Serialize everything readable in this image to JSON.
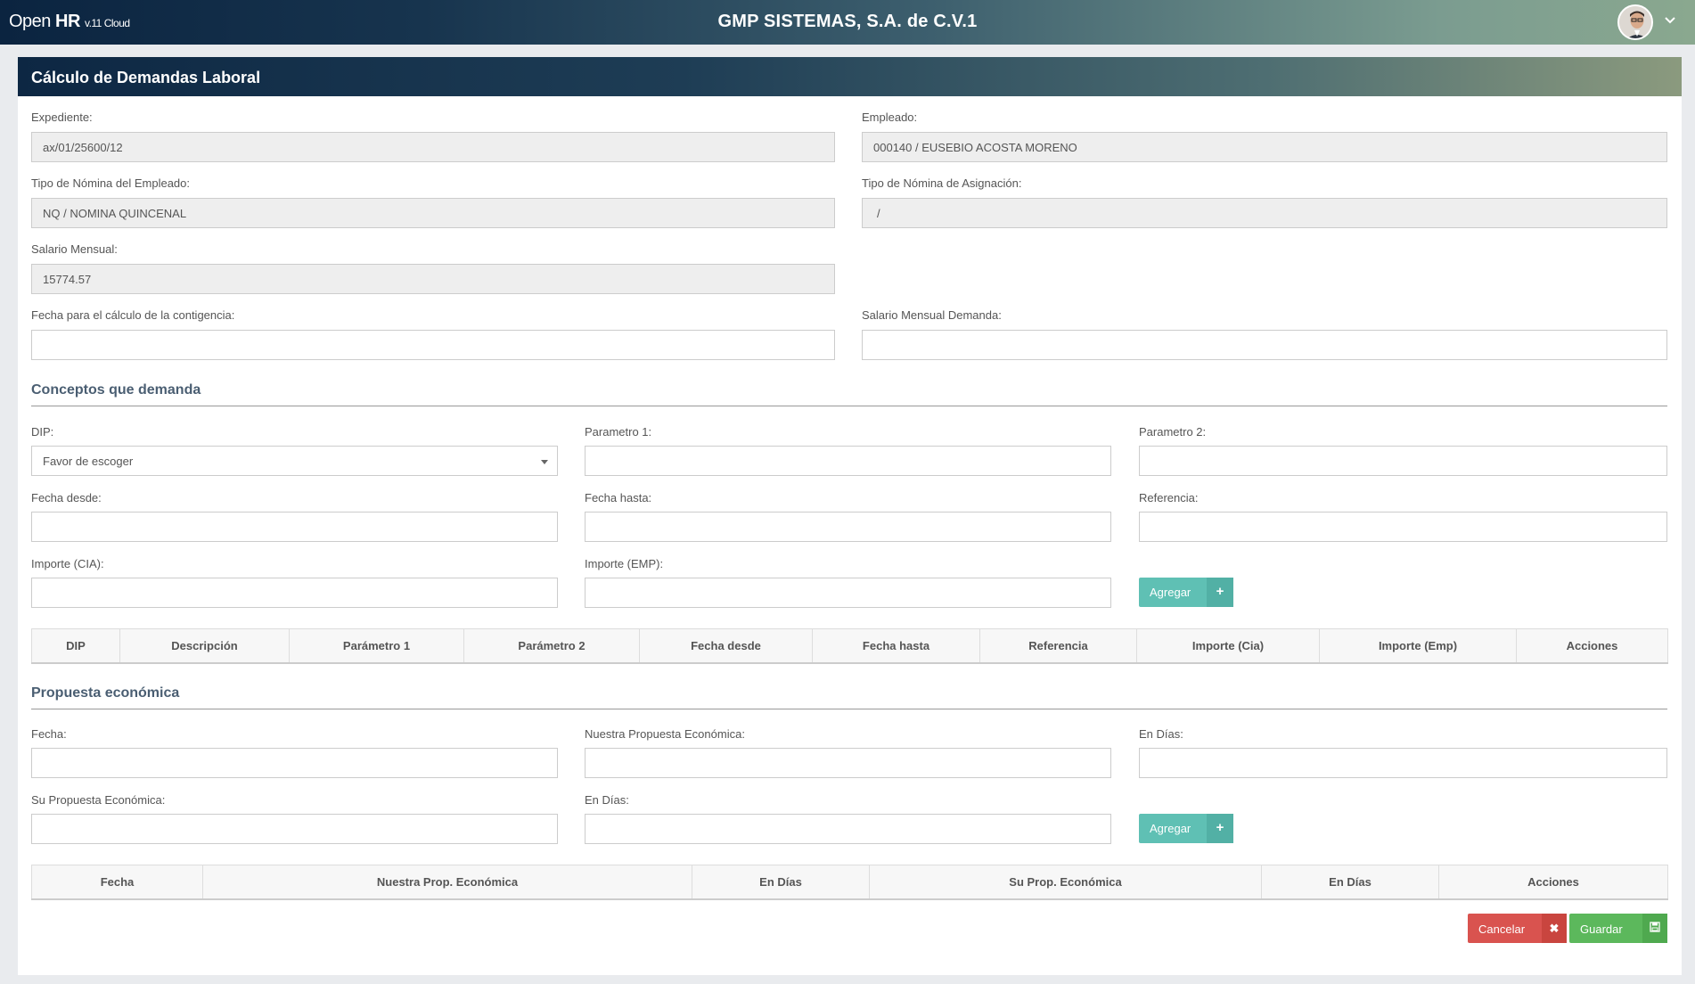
{
  "brand": {
    "open": "Open",
    "hr": "HR",
    "version": "v.11 Cloud"
  },
  "company": "GMP SISTEMAS, S.A. de C.V.1",
  "title": "Cálculo de Demandas Laboral",
  "fields": {
    "expediente": {
      "label": "Expediente:",
      "value": "ax/01/25600/12"
    },
    "empleado": {
      "label": "Empleado:",
      "value": "000140 / EUSEBIO ACOSTA MORENO"
    },
    "tipo_nomina_empleado": {
      "label": "Tipo de Nómina del Empleado:",
      "value": "NQ / NOMINA QUINCENAL"
    },
    "tipo_nomina_asignacion": {
      "label": "Tipo de Nómina de Asignación:",
      "value": "/"
    },
    "salario_mensual": {
      "label": "Salario Mensual:",
      "value": "15774.57"
    },
    "fecha_contingencia": {
      "label": "Fecha para el cálculo de la contigencia:",
      "value": ""
    },
    "salario_mensual_demanda": {
      "label": "Salario Mensual Demanda:",
      "value": ""
    }
  },
  "conceptos": {
    "heading": "Conceptos que demanda",
    "dip": {
      "label": "DIP:",
      "value": "Favor de escoger"
    },
    "parametro1": {
      "label": "Parametro 1:",
      "value": ""
    },
    "parametro2": {
      "label": "Parametro 2:",
      "value": ""
    },
    "fecha_desde": {
      "label": "Fecha desde:",
      "value": ""
    },
    "fecha_hasta": {
      "label": "Fecha hasta:",
      "value": ""
    },
    "referencia": {
      "label": "Referencia:",
      "value": ""
    },
    "importe_cia": {
      "label": "Importe (CIA):",
      "value": ""
    },
    "importe_emp": {
      "label": "Importe (EMP):",
      "value": ""
    },
    "add_label": "Agregar",
    "columns": [
      "DIP",
      "Descripción",
      "Parámetro 1",
      "Parámetro 2",
      "Fecha desde",
      "Fecha hasta",
      "Referencia",
      "Importe (Cia)",
      "Importe (Emp)",
      "Acciones"
    ]
  },
  "propuesta": {
    "heading": "Propuesta económica",
    "fecha": {
      "label": "Fecha:",
      "value": ""
    },
    "nuestra": {
      "label": "Nuestra Propuesta Económica:",
      "value": ""
    },
    "en_dias_1": {
      "label": "En Días:",
      "value": ""
    },
    "su": {
      "label": "Su Propuesta Económica:",
      "value": ""
    },
    "en_dias_2": {
      "label": "En Días:",
      "value": ""
    },
    "add_label": "Agregar",
    "columns": [
      "Fecha",
      "Nuestra Prop. Económica",
      "En Días",
      "Su Prop. Económica",
      "En Días",
      "Acciones"
    ]
  },
  "actions": {
    "cancel": "Cancelar",
    "save": "Guardar"
  },
  "colors": {
    "add_button": "#5fc0b4",
    "cancel_button": "#d9534f",
    "save_button": "#5cb85c"
  }
}
